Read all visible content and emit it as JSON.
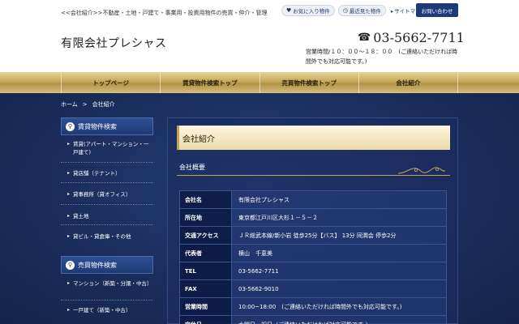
{
  "header": {
    "tagline": "<<会社紹介>>不動産・土地・戸建て・事業用・投資用物件の売買・仲介・管理",
    "company_name": "有限会社プレシャス",
    "favorites_label": "お気に入り物件",
    "recent_label": "最近見た物件",
    "sitemap_label": "サイトマップ",
    "contact_label": "お問い合わせ",
    "phone": "03-5662-7711",
    "hours": "営業時間/１０：００〜１８：００　(ご連絡いただければ時間外でも対応可能です。)"
  },
  "nav": {
    "items": [
      {
        "label": "トップページ"
      },
      {
        "label": "賃貸物件検索トップ"
      },
      {
        "label": "売買物件検索トップ"
      },
      {
        "label": "会社紹介"
      }
    ]
  },
  "breadcrumb": {
    "home": "ホーム",
    "separator": ">",
    "current": "会社紹介"
  },
  "sidebar": {
    "rental": {
      "title": "賃貸物件検索",
      "items": [
        {
          "label": "賃貸(アパート・マンション・一戸建て)"
        },
        {
          "label": "貸店舗（テナント）"
        },
        {
          "label": "貸事務所（貸オフィス）"
        },
        {
          "label": "貸土地"
        },
        {
          "label": "貸ビル・貸倉庫・その他"
        }
      ]
    },
    "sale": {
      "title": "売買物件検索",
      "items": [
        {
          "label": "マンション（新築・分譲・中古）"
        },
        {
          "label": "一戸建て（新築・中古）"
        }
      ]
    }
  },
  "main": {
    "page_title": "会社紹介",
    "section_title": "会社概要",
    "table": [
      {
        "label": "会社名",
        "value": "有限会社プレシャス"
      },
      {
        "label": "所在地",
        "value": "東京都江戸川区大杉１－５－２"
      },
      {
        "label": "交通アクセス",
        "value": "ＪＲ総武本線/新小岩 徒歩25分【バス】 13分 同潤会 停歩2分"
      },
      {
        "label": "代表者",
        "value": "横山　千恵美"
      },
      {
        "label": "TEL",
        "value": "03-5662-7711"
      },
      {
        "label": "FAX",
        "value": "03-5662-9010"
      },
      {
        "label": "営業時間",
        "value": "10:00~18:00　(ご連絡いただければ時間外でも対応可能です。)"
      },
      {
        "label": "定休日",
        "value": "水曜日・祝日（ご連絡いただければ対応可能です。）"
      }
    ]
  },
  "colors": {
    "navy": "#1d3a78",
    "gold": "#c4a256",
    "background": "#1a2d5c"
  }
}
